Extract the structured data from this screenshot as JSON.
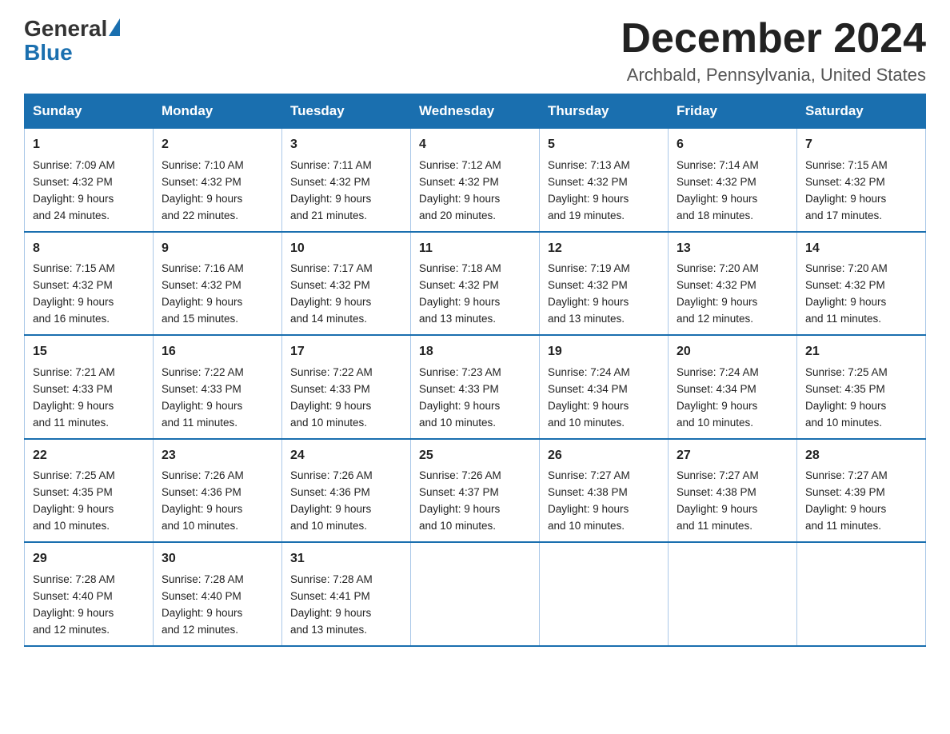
{
  "header": {
    "logo_general": "General",
    "logo_blue": "Blue",
    "month_title": "December 2024",
    "location": "Archbald, Pennsylvania, United States"
  },
  "weekdays": [
    "Sunday",
    "Monday",
    "Tuesday",
    "Wednesday",
    "Thursday",
    "Friday",
    "Saturday"
  ],
  "weeks": [
    [
      {
        "day": "1",
        "sunrise": "7:09 AM",
        "sunset": "4:32 PM",
        "daylight": "9 hours and 24 minutes."
      },
      {
        "day": "2",
        "sunrise": "7:10 AM",
        "sunset": "4:32 PM",
        "daylight": "9 hours and 22 minutes."
      },
      {
        "day": "3",
        "sunrise": "7:11 AM",
        "sunset": "4:32 PM",
        "daylight": "9 hours and 21 minutes."
      },
      {
        "day": "4",
        "sunrise": "7:12 AM",
        "sunset": "4:32 PM",
        "daylight": "9 hours and 20 minutes."
      },
      {
        "day": "5",
        "sunrise": "7:13 AM",
        "sunset": "4:32 PM",
        "daylight": "9 hours and 19 minutes."
      },
      {
        "day": "6",
        "sunrise": "7:14 AM",
        "sunset": "4:32 PM",
        "daylight": "9 hours and 18 minutes."
      },
      {
        "day": "7",
        "sunrise": "7:15 AM",
        "sunset": "4:32 PM",
        "daylight": "9 hours and 17 minutes."
      }
    ],
    [
      {
        "day": "8",
        "sunrise": "7:15 AM",
        "sunset": "4:32 PM",
        "daylight": "9 hours and 16 minutes."
      },
      {
        "day": "9",
        "sunrise": "7:16 AM",
        "sunset": "4:32 PM",
        "daylight": "9 hours and 15 minutes."
      },
      {
        "day": "10",
        "sunrise": "7:17 AM",
        "sunset": "4:32 PM",
        "daylight": "9 hours and 14 minutes."
      },
      {
        "day": "11",
        "sunrise": "7:18 AM",
        "sunset": "4:32 PM",
        "daylight": "9 hours and 13 minutes."
      },
      {
        "day": "12",
        "sunrise": "7:19 AM",
        "sunset": "4:32 PM",
        "daylight": "9 hours and 13 minutes."
      },
      {
        "day": "13",
        "sunrise": "7:20 AM",
        "sunset": "4:32 PM",
        "daylight": "9 hours and 12 minutes."
      },
      {
        "day": "14",
        "sunrise": "7:20 AM",
        "sunset": "4:32 PM",
        "daylight": "9 hours and 11 minutes."
      }
    ],
    [
      {
        "day": "15",
        "sunrise": "7:21 AM",
        "sunset": "4:33 PM",
        "daylight": "9 hours and 11 minutes."
      },
      {
        "day": "16",
        "sunrise": "7:22 AM",
        "sunset": "4:33 PM",
        "daylight": "9 hours and 11 minutes."
      },
      {
        "day": "17",
        "sunrise": "7:22 AM",
        "sunset": "4:33 PM",
        "daylight": "9 hours and 10 minutes."
      },
      {
        "day": "18",
        "sunrise": "7:23 AM",
        "sunset": "4:33 PM",
        "daylight": "9 hours and 10 minutes."
      },
      {
        "day": "19",
        "sunrise": "7:24 AM",
        "sunset": "4:34 PM",
        "daylight": "9 hours and 10 minutes."
      },
      {
        "day": "20",
        "sunrise": "7:24 AM",
        "sunset": "4:34 PM",
        "daylight": "9 hours and 10 minutes."
      },
      {
        "day": "21",
        "sunrise": "7:25 AM",
        "sunset": "4:35 PM",
        "daylight": "9 hours and 10 minutes."
      }
    ],
    [
      {
        "day": "22",
        "sunrise": "7:25 AM",
        "sunset": "4:35 PM",
        "daylight": "9 hours and 10 minutes."
      },
      {
        "day": "23",
        "sunrise": "7:26 AM",
        "sunset": "4:36 PM",
        "daylight": "9 hours and 10 minutes."
      },
      {
        "day": "24",
        "sunrise": "7:26 AM",
        "sunset": "4:36 PM",
        "daylight": "9 hours and 10 minutes."
      },
      {
        "day": "25",
        "sunrise": "7:26 AM",
        "sunset": "4:37 PM",
        "daylight": "9 hours and 10 minutes."
      },
      {
        "day": "26",
        "sunrise": "7:27 AM",
        "sunset": "4:38 PM",
        "daylight": "9 hours and 10 minutes."
      },
      {
        "day": "27",
        "sunrise": "7:27 AM",
        "sunset": "4:38 PM",
        "daylight": "9 hours and 11 minutes."
      },
      {
        "day": "28",
        "sunrise": "7:27 AM",
        "sunset": "4:39 PM",
        "daylight": "9 hours and 11 minutes."
      }
    ],
    [
      {
        "day": "29",
        "sunrise": "7:28 AM",
        "sunset": "4:40 PM",
        "daylight": "9 hours and 12 minutes."
      },
      {
        "day": "30",
        "sunrise": "7:28 AM",
        "sunset": "4:40 PM",
        "daylight": "9 hours and 12 minutes."
      },
      {
        "day": "31",
        "sunrise": "7:28 AM",
        "sunset": "4:41 PM",
        "daylight": "9 hours and 13 minutes."
      },
      null,
      null,
      null,
      null
    ]
  ],
  "labels": {
    "sunrise": "Sunrise:",
    "sunset": "Sunset:",
    "daylight": "Daylight:"
  }
}
